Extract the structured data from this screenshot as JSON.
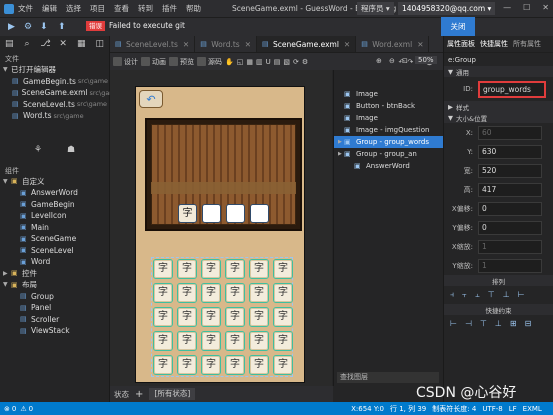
{
  "menu": {
    "items": [
      "文件",
      "编辑",
      "选择",
      "项目",
      "查看",
      "转到",
      "插件",
      "帮助"
    ],
    "window_title": "SceneGame.exml - GuessWord - Egret Wing",
    "role": "程序员 ▾",
    "account": "1404958320@qq.com ▾",
    "win_min": "—",
    "win_max": "☐",
    "win_close": "✕"
  },
  "notice": {
    "badge": "错误",
    "message": "Failed to execute git",
    "close": "关闭"
  },
  "left": {
    "files_header": "文件",
    "open_editors": "已打开编辑器",
    "open_files": [
      {
        "name": "GameBegin.ts",
        "path": "src\\game"
      },
      {
        "name": "SceneGame.exml",
        "path": "src\\game"
      },
      {
        "name": "SceneLevel.ts",
        "path": "src\\game"
      },
      {
        "name": "Word.ts",
        "path": "src\\game"
      }
    ],
    "components_header": "组件",
    "custom_label": "自定义",
    "custom_items": [
      "AnswerWord",
      "GameBegin",
      "LevelIcon",
      "Main",
      "SceneGame",
      "SceneLevel",
      "Word"
    ],
    "controls_label": "控件",
    "layout_label": "布局",
    "layout_items": [
      "Group",
      "Panel",
      "Scroller",
      "ViewStack"
    ]
  },
  "tabs": [
    {
      "label": "SceneLevel.ts",
      "active": false
    },
    {
      "label": "Word.ts",
      "active": false
    },
    {
      "label": "SceneGame.exml",
      "active": true
    },
    {
      "label": "Word.exml",
      "active": false
    }
  ],
  "editbar": {
    "design": "设计",
    "anim": "动画",
    "preview": "预览",
    "source": "源码",
    "zoom": "50%"
  },
  "canvas": {
    "word_char": "字"
  },
  "bottom": {
    "status": "状态",
    "add": "+",
    "all_states": "[所有状态]"
  },
  "layers": {
    "items": [
      {
        "label": "Image",
        "indent": 0,
        "selected": false
      },
      {
        "label": "Button - btnBack",
        "indent": 0,
        "selected": false
      },
      {
        "label": "Image",
        "indent": 0,
        "selected": false
      },
      {
        "label": "Image - imgQuestion",
        "indent": 0,
        "selected": false
      },
      {
        "label": "Group - group_words",
        "indent": 0,
        "selected": true
      },
      {
        "label": "Group - group_an",
        "indent": 0,
        "selected": false
      },
      {
        "label": "AnswerWord",
        "indent": 1,
        "selected": false
      }
    ],
    "search_placeholder": "查找图层"
  },
  "props": {
    "tabs": [
      "属性面板",
      "快捷属性",
      "所有属性"
    ],
    "group": "e:Group",
    "common": "通用",
    "id_label": "ID:",
    "id_value": "group_words",
    "style": "样式",
    "size_pos": "大小&位置",
    "fields": [
      {
        "label": "X:",
        "value": "60",
        "dim": true
      },
      {
        "label": "Y:",
        "value": "630",
        "dim": false
      },
      {
        "label": "宽:",
        "value": "520",
        "dim": false
      },
      {
        "label": "高:",
        "value": "417",
        "dim": false
      },
      {
        "label": "X偏移:",
        "value": "0",
        "dim": false
      },
      {
        "label": "Y偏移:",
        "value": "0",
        "dim": false
      },
      {
        "label": "X缩放:",
        "value": "1",
        "dim": true
      },
      {
        "label": "Y缩放:",
        "value": "1",
        "dim": true
      }
    ],
    "arrange": "排列",
    "constraints": "快捷约束"
  },
  "status": {
    "pos": "X:654 Y:0",
    "line": "行 1, 列 39",
    "tab_len": "制表符长度: 4",
    "encoding": "UTF-8",
    "eol": "LF",
    "lang": "EXML",
    "errors": "0",
    "warnings": "0"
  },
  "watermark": "CSDN @心谷好"
}
